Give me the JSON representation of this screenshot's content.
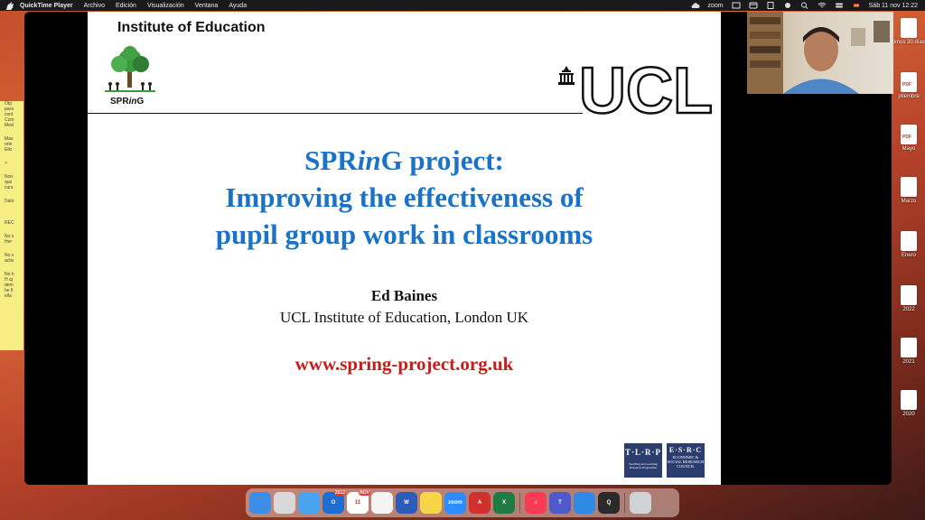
{
  "menubar": {
    "app_name": "QuickTime Player",
    "items": [
      "Archivo",
      "Edición",
      "Visualización",
      "Ventana",
      "Ayuda"
    ],
    "zoom_label": "zoom",
    "clock": "Sáb 11 nov 12:22"
  },
  "slide": {
    "header": "Institute of Education",
    "logo_label": "SPRinG",
    "ucl_text": "UCL",
    "title_lines": [
      "SPRinG project:",
      "Improving the effectiveness of",
      "pupil group work in classrooms"
    ],
    "author": "Ed Baines",
    "institution": "UCL Institute of Education, London UK",
    "url": "www.spring-project.org.uk",
    "tlrp": {
      "abbr": "T·L·R·P",
      "caption": "Teaching and Learning Research Programme"
    },
    "esrc": {
      "abbr": "E·S·R·C",
      "caption": "ECONOMIC & SOCIAL RESEARCH COUNCIL"
    }
  },
  "notes_lines": [
    "Obj",
    "para",
    "cont",
    "Com",
    "Mod",
    "",
    "Mas",
    "orie",
    "Ello",
    "",
    ">",
    "",
    "Non",
    "que",
    "curs",
    "",
    "Dato",
    "",
    "",
    "REC",
    "",
    "No s",
    "Her",
    "",
    "No v",
    "activ",
    "",
    "No h",
    "H aj",
    "dem",
    "he fi",
    "ella"
  ],
  "desktop_items": [
    {
      "caption": "timos 30 días",
      "type": "folder"
    },
    {
      "caption": "ptiembre",
      "type": "pdf"
    },
    {
      "caption": "Mayo",
      "type": "pdf"
    },
    {
      "caption": "Marzo",
      "type": "doc"
    },
    {
      "caption": "Enero",
      "type": "docx"
    },
    {
      "caption": "2022",
      "type": "doc"
    },
    {
      "caption": "2021",
      "type": "docx"
    },
    {
      "caption": "2020",
      "type": "doc"
    }
  ],
  "dock": {
    "apps": [
      {
        "name": "finder-icon",
        "label": "",
        "color": "#3b8de6"
      },
      {
        "name": "launchpad-icon",
        "label": "",
        "color": "#d9d9d9"
      },
      {
        "name": "mail-icon",
        "label": "",
        "color": "#4aa3ef"
      },
      {
        "name": "outlook-icon",
        "label": "O",
        "color": "#1f6ed4",
        "badge": "2012"
      },
      {
        "name": "calendar-icon",
        "label": "11",
        "color": "#ffffff",
        "badge": "NOV"
      },
      {
        "name": "chrome-icon",
        "label": "",
        "color": "#f4f4f4"
      },
      {
        "name": "word-icon",
        "label": "W",
        "color": "#2b5db8"
      },
      {
        "name": "notes-icon",
        "label": "",
        "color": "#f7d548"
      },
      {
        "name": "zoom-icon",
        "label": "zoom",
        "color": "#2d8cff"
      },
      {
        "name": "acrobat-icon",
        "label": "A",
        "color": "#d0312d"
      },
      {
        "name": "excel-icon",
        "label": "X",
        "color": "#1f7a44"
      },
      {
        "name": "music-icon",
        "label": "♫",
        "color": "#fa3b54"
      },
      {
        "name": "teams-icon",
        "label": "T",
        "color": "#5059c9"
      },
      {
        "name": "safari-icon",
        "label": "",
        "color": "#2f8ae6"
      },
      {
        "name": "quicktime-icon",
        "label": "Q",
        "color": "#2a2a2a"
      },
      {
        "name": "trash-icon",
        "label": "",
        "color": "#cfd2d6"
      }
    ]
  }
}
